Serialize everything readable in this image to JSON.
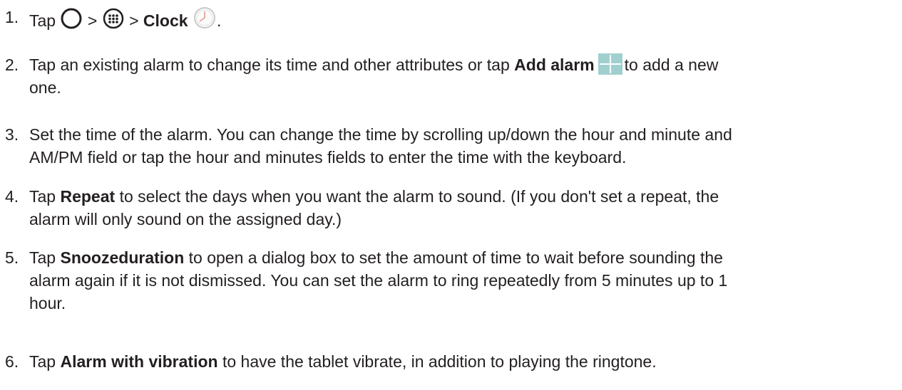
{
  "steps": [
    {
      "number": "1.",
      "tap": "Tap",
      "sep1": ">",
      "sep2": ">",
      "clock_label": "Clock",
      "end": ".",
      "icons": [
        "home-circle-icon",
        "apps-icon",
        "clock-icon"
      ]
    },
    {
      "number": "2.",
      "pre": "Tap an existing alarm to change its time and other attributes or tap",
      "bold": "Add alarm",
      "post": "to add a new",
      "line2": "one.",
      "icon": "add-plus-icon"
    },
    {
      "number": "3.",
      "line1": "Set the time of the alarm. You can change the time by scrolling up/down the hour and minute and",
      "line2": "AM/PM field or tap the hour and minutes fields to enter the time with the keyboard."
    },
    {
      "number": "4.",
      "pre": "Tap",
      "bold": "Repeat",
      "post": "to select the days when you want the alarm to sound. (If you don't set a repeat, the",
      "line2": "alarm will only sound on the assigned day.)"
    },
    {
      "number": "5.",
      "pre": "Tap",
      "bold": "Snoozeduration",
      "post": "to open a dialog box to set the amount of time to wait before sounding the",
      "line2": "alarm again if it is not dismissed. You can set the alarm to ring repeatedly from 5 minutes up to 1",
      "line3": "hour."
    },
    {
      "number": "6.",
      "pre": "Tap",
      "bold": "Alarm with vibration",
      "post": "to have the tablet vibrate, in addition to playing the ringtone."
    }
  ],
  "colors": {
    "text": "#231f20",
    "icon_accent": "#7ec8c8",
    "add_icon_bg": "#9fd0cf"
  }
}
